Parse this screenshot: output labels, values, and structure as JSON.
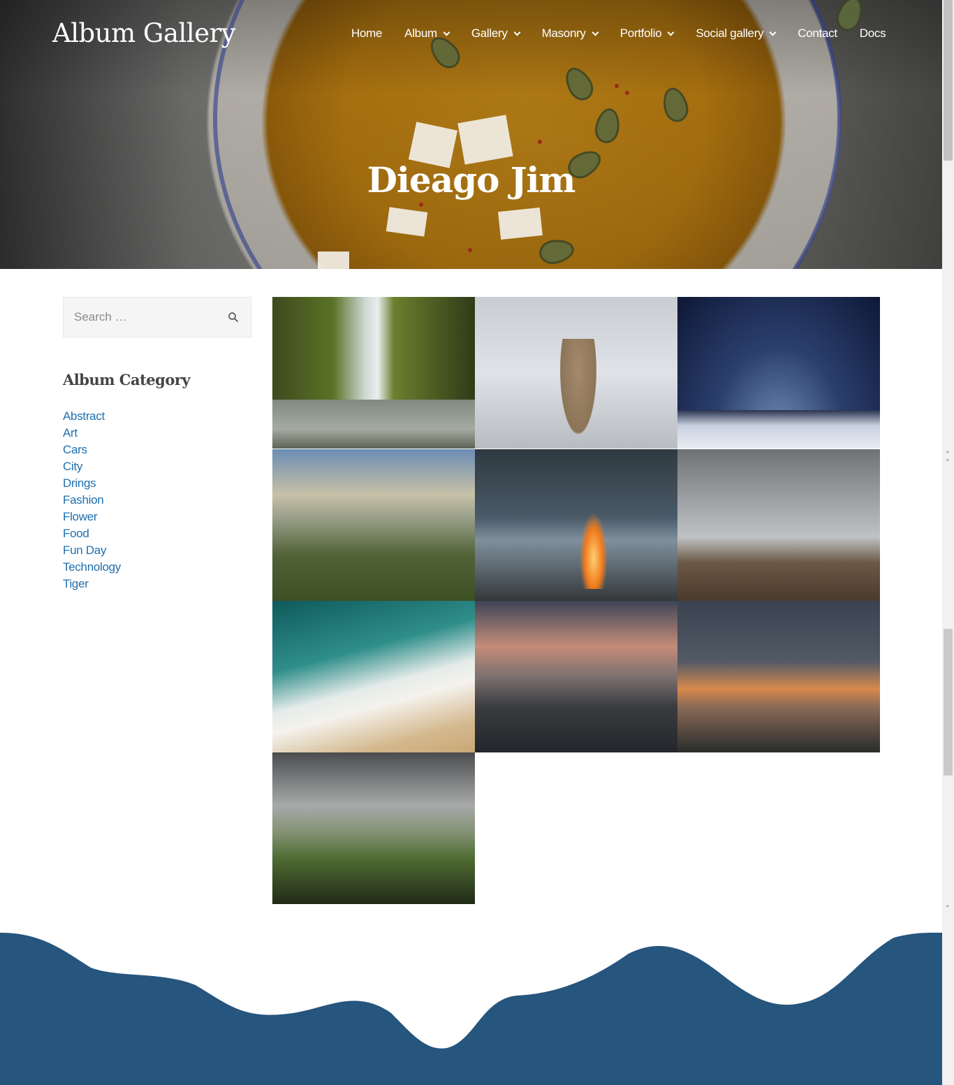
{
  "site": {
    "brand": "Album Gallery"
  },
  "nav": {
    "items": [
      {
        "label": "Home"
      },
      {
        "label": "Album"
      },
      {
        "label": "Gallery"
      },
      {
        "label": "Masonry"
      },
      {
        "label": "Portfolio"
      },
      {
        "label": "Social gallery"
      },
      {
        "label": "Contact"
      },
      {
        "label": "Docs"
      }
    ]
  },
  "hero": {
    "title": "Dieago Jim"
  },
  "sidebar": {
    "search_placeholder": "Search …",
    "widget_title": "Album Category",
    "categories": [
      "Abstract",
      "Art",
      "Cars",
      "City",
      "Drings",
      "Fashion",
      "Flower",
      "Food",
      "Fun Day",
      "Technology",
      "Tiger"
    ]
  },
  "gallery": {
    "images": [
      "waterfall",
      "deer",
      "starry-sky",
      "valley",
      "campfire",
      "misty-plain",
      "sea-shore",
      "city-skyline",
      "sunset-sky",
      "mesa-mountain"
    ]
  },
  "colors": {
    "accent_link": "#1f6fae",
    "footer_wave": "#26557d"
  }
}
